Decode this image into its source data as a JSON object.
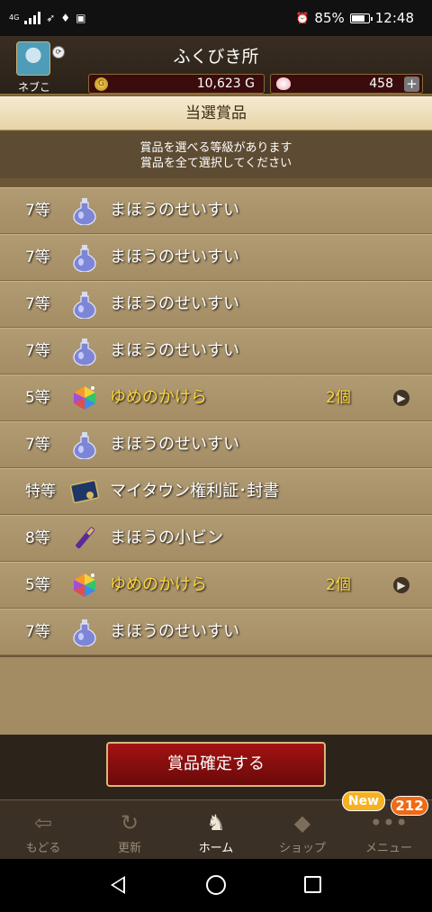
{
  "status_bar": {
    "network": "4G",
    "battery_text": "85%",
    "battery_level": 0.85,
    "time": "12:48"
  },
  "header": {
    "user_name": "ネブこ",
    "title": "ふくびき所",
    "gold_value": "10,623 G",
    "gem_value": "458",
    "plus_label": "+"
  },
  "section_title": "当選賞品",
  "notice": {
    "line1": "賞品を選べる等級があります",
    "line2": "賞品を全て選択してください"
  },
  "items": [
    {
      "grade": "7等",
      "name": "まほうのせいすい",
      "qty": "",
      "icon": "potion-icon",
      "highlight": false
    },
    {
      "grade": "7等",
      "name": "まほうのせいすい",
      "qty": "",
      "icon": "potion-icon",
      "highlight": false
    },
    {
      "grade": "7等",
      "name": "まほうのせいすい",
      "qty": "",
      "icon": "potion-icon",
      "highlight": false
    },
    {
      "grade": "7等",
      "name": "まほうのせいすい",
      "qty": "",
      "icon": "potion-icon",
      "highlight": false
    },
    {
      "grade": "5等",
      "name": "ゆめのかけら",
      "qty": "2個",
      "icon": "rainbow-gem-icon",
      "highlight": true
    },
    {
      "grade": "7等",
      "name": "まほうのせいすい",
      "qty": "",
      "icon": "potion-icon",
      "highlight": false
    },
    {
      "grade": "特等",
      "name": "マイタウン権利証･封書",
      "qty": "",
      "icon": "sealed-letter-icon",
      "highlight": false
    },
    {
      "grade": "8等",
      "name": "まほうの小ビン",
      "qty": "",
      "icon": "vial-icon",
      "highlight": false
    },
    {
      "grade": "5等",
      "name": "ゆめのかけら",
      "qty": "2個",
      "icon": "rainbow-gem-icon",
      "highlight": true
    },
    {
      "grade": "7等",
      "name": "まほうのせいすい",
      "qty": "",
      "icon": "potion-icon",
      "highlight": false
    }
  ],
  "confirm_button": "賞品確定する",
  "bottom_nav": {
    "back": "もどる",
    "refresh": "更新",
    "home": "ホーム",
    "shop": "ショップ",
    "menu": "メニュー",
    "new_badge": "New",
    "count_badge": "212"
  },
  "colors": {
    "highlight_text": "#ffd53a",
    "confirm_button": "#8b0e0e",
    "row_bg": "#a9936b"
  }
}
